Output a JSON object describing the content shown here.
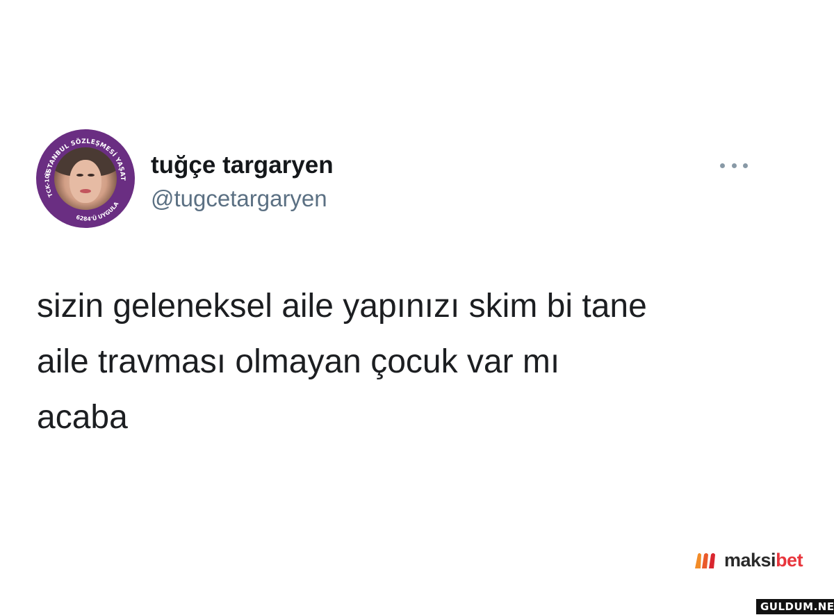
{
  "tweet": {
    "display_name": "tuğçe targaryen",
    "handle": "@tugcetargaryen",
    "avatar": {
      "ring_text_top": "İSTANBUL SÖZLEŞMESİ YAŞATIR",
      "ring_text_left": "TCK-103",
      "ring_text_bottom": "6284'Ü UYGULA",
      "ring_color": "#6a2e82"
    },
    "more_icon": "more-horizontal-icon",
    "text_lines": [
      "sizin geleneksel aile yapınızı skim bi tane",
      "aile travması olmayan çocuk var mı",
      "acaba"
    ]
  },
  "watermarks": {
    "maksibet": {
      "prefix": "maksi",
      "suffix": "bet",
      "brand_color": "#e8363d"
    },
    "site": "GULDUM.NET"
  }
}
